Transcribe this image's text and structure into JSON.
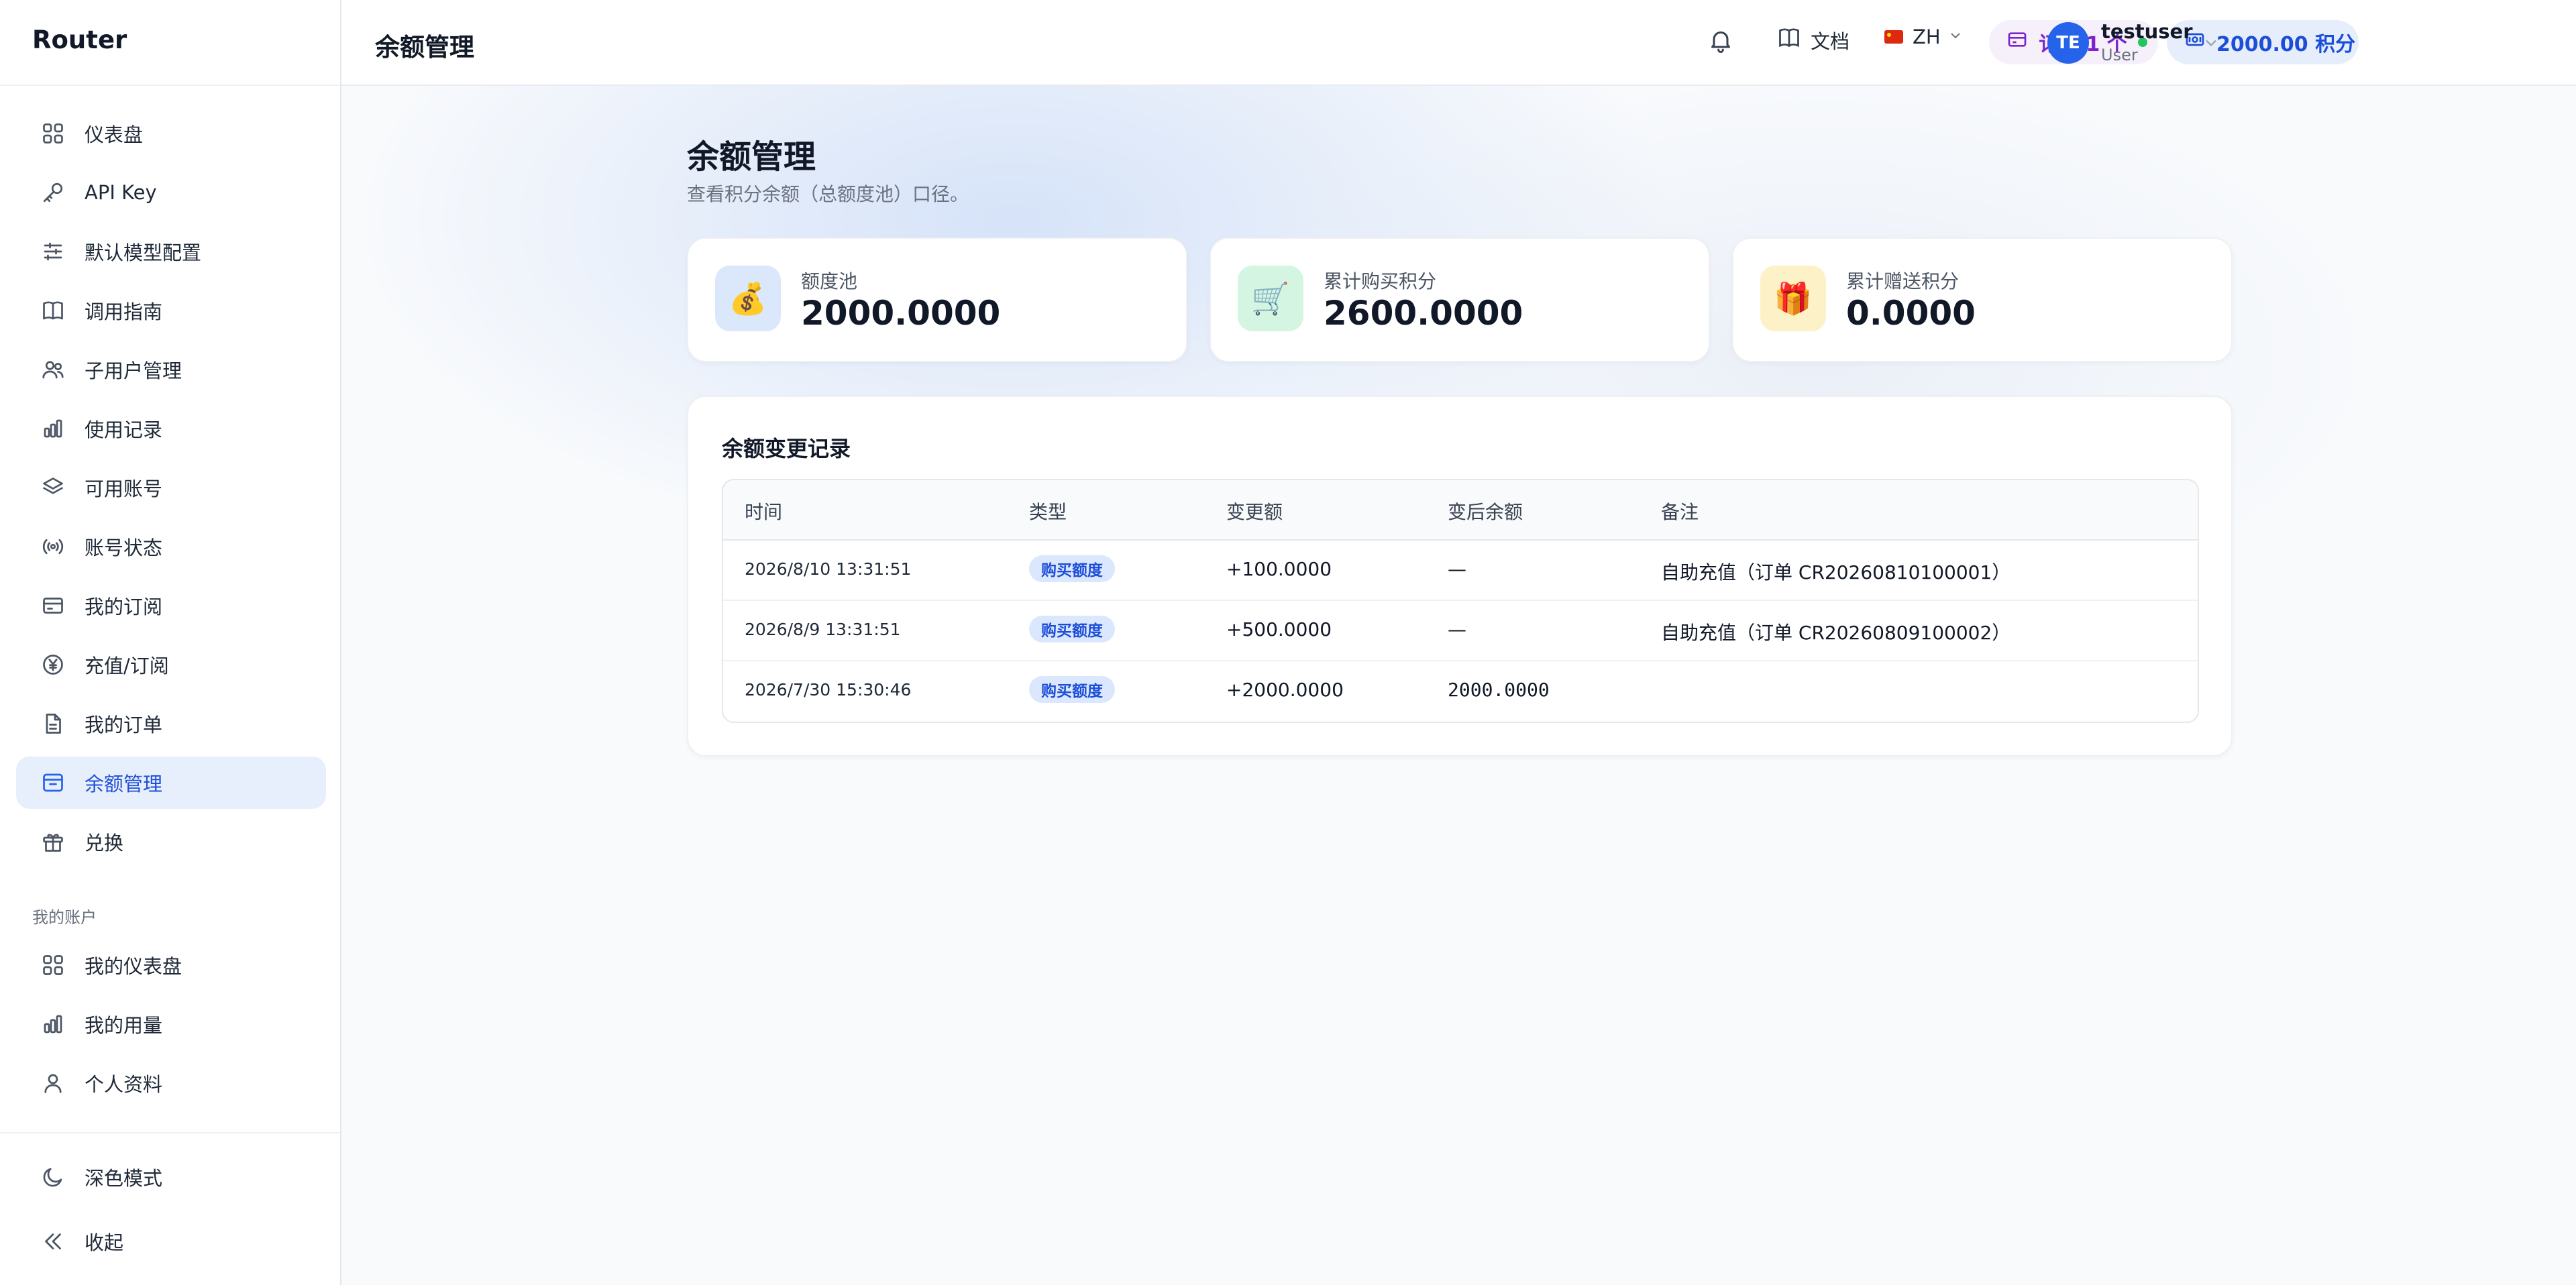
{
  "brand": "Router",
  "sidebar": {
    "items": [
      {
        "label": "仪表盘",
        "icon": "grid-icon"
      },
      {
        "label": "API Key",
        "icon": "key-icon"
      },
      {
        "label": "默认模型配置",
        "icon": "sliders-icon"
      },
      {
        "label": "调用指南",
        "icon": "book-icon"
      },
      {
        "label": "子用户管理",
        "icon": "users-icon"
      },
      {
        "label": "使用记录",
        "icon": "bar-chart-icon"
      },
      {
        "label": "可用账号",
        "icon": "layers-icon"
      },
      {
        "label": "账号状态",
        "icon": "signal-icon"
      },
      {
        "label": "我的订阅",
        "icon": "credit-card-icon"
      },
      {
        "label": "充值/订阅",
        "icon": "yen-circle-icon"
      },
      {
        "label": "我的订单",
        "icon": "file-icon"
      },
      {
        "label": "余额管理",
        "icon": "wallet-icon"
      },
      {
        "label": "兑换",
        "icon": "gift-icon"
      }
    ],
    "section_label": "我的账户",
    "account_items": [
      {
        "label": "我的仪表盘",
        "icon": "grid-icon"
      },
      {
        "label": "我的用量",
        "icon": "bar-chart-icon"
      },
      {
        "label": "个人资料",
        "icon": "user-icon"
      }
    ],
    "dark_mode": "深色模式",
    "collapse": "收起"
  },
  "header": {
    "title": "余额管理",
    "docs": "文档",
    "lang": "ZH",
    "subscription": "订阅 1 个",
    "credits": "2000.00 积分",
    "avatar_initials": "TE",
    "username": "testuser",
    "role": "User"
  },
  "page": {
    "title": "余额管理",
    "subtitle": "查看积分余额（总额度池）口径。"
  },
  "stats": [
    {
      "label": "额度池",
      "value": "2000.0000",
      "icon": "money-bag-icon",
      "bg": "#dbe8fb"
    },
    {
      "label": "累计购买积分",
      "value": "2600.0000",
      "icon": "cart-icon",
      "bg": "#d5f5e3"
    },
    {
      "label": "累计赠送积分",
      "value": "0.0000",
      "icon": "gift-icon",
      "bg": "#fdf1c7"
    }
  ],
  "records": {
    "title": "余额变更记录",
    "columns": [
      "时间",
      "类型",
      "变更额",
      "变后余额",
      "备注"
    ],
    "rows": [
      {
        "time": "2026/8/10 13:31:51",
        "type": "购买额度",
        "delta": "+100.0000",
        "after": "—",
        "note": "自助充值（订单 CR20260810100001）"
      },
      {
        "time": "2026/8/9 13:31:51",
        "type": "购买额度",
        "delta": "+500.0000",
        "after": "—",
        "note": "自助充值（订单 CR20260809100002）"
      },
      {
        "time": "2026/7/30 15:30:46",
        "type": "购买额度",
        "delta": "+2000.0000",
        "after": "2000.0000",
        "note": ""
      }
    ]
  },
  "colors": {
    "accent": "#2563eb",
    "active_bg": "#e8effc",
    "subscription": "#7e22ce",
    "badge_bg": "#dbe7fd"
  }
}
